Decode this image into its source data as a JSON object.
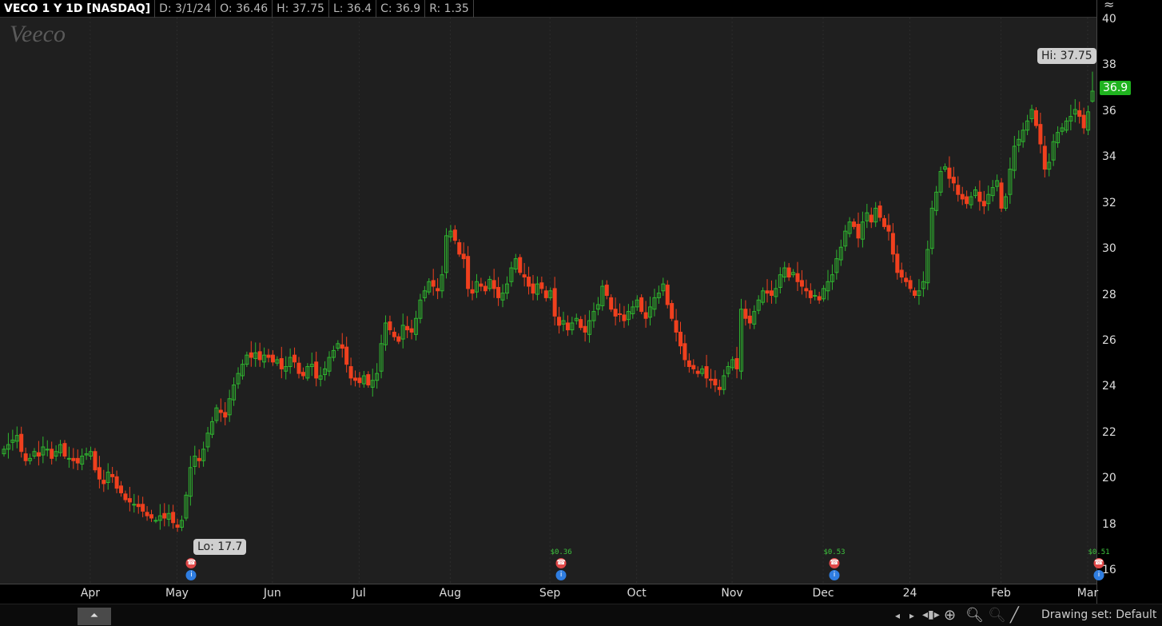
{
  "header": {
    "symbol": "VECO 1 Y 1D [NASDAQ]",
    "date": "D: 3/1/24",
    "open": "O: 36.46",
    "high": "H: 37.75",
    "low": "L: 36.4",
    "close": "C: 36.9",
    "range": "R: 1.35"
  },
  "logo_text": "Veeco",
  "labels": {
    "hi": "Hi: 37.75",
    "lo": "Lo: 17.7",
    "last_price": "36.9"
  },
  "events": [
    {
      "dividend": "",
      "month_index": 1
    },
    {
      "dividend": "$0.36",
      "month_index": 5
    },
    {
      "dividend": "$0.53",
      "month_index": 8
    },
    {
      "dividend": "$0.51",
      "month_index": 11
    }
  ],
  "toolbar": {
    "drawing_set": "Drawing set: Default",
    "collapse": "⏶"
  },
  "colors": {
    "up": "#2fb52f",
    "down": "#f0401e",
    "bg": "#1f1f1f"
  },
  "chart_data": {
    "type": "candlestick",
    "title": "VECO 1 Y 1D [NASDAQ]",
    "ylim": [
      16,
      40
    ],
    "yticks": [
      16,
      18,
      20,
      22,
      24,
      26,
      28,
      30,
      32,
      34,
      36,
      38,
      40
    ],
    "xticks": [
      "Apr",
      "May",
      "Jun",
      "Jul",
      "Aug",
      "Sep",
      "Oct",
      "Nov",
      "Dec",
      "24",
      "Feb",
      "Mar"
    ],
    "xtick_day_index": [
      21,
      41,
      63,
      83,
      104,
      127,
      147,
      169,
      190,
      210,
      231,
      251
    ],
    "closes": [
      21.3,
      21.5,
      21.7,
      21.9,
      21.2,
      20.8,
      20.9,
      21.2,
      21.0,
      21.4,
      21.3,
      20.9,
      21.2,
      21.5,
      21.0,
      20.9,
      20.8,
      20.7,
      21.0,
      21.1,
      21.2,
      20.4,
      20.0,
      19.8,
      20.3,
      20.1,
      19.6,
      19.4,
      19.1,
      19.0,
      18.9,
      18.8,
      18.6,
      18.4,
      18.3,
      18.2,
      18.4,
      18.3,
      18.5,
      18.1,
      17.9,
      18.2,
      19.3,
      20.5,
      21.0,
      20.8,
      21.3,
      22.0,
      22.5,
      23.1,
      22.9,
      22.7,
      23.5,
      24.1,
      24.6,
      25.0,
      25.4,
      25.3,
      25.5,
      25.2,
      25.4,
      25.3,
      25.1,
      25.2,
      24.8,
      24.9,
      25.3,
      25.1,
      24.6,
      24.5,
      24.9,
      25.0,
      24.4,
      24.5,
      24.8,
      25.3,
      25.6,
      25.9,
      25.7,
      25.0,
      24.4,
      24.3,
      24.2,
      24.5,
      24.1,
      24.3,
      24.6,
      25.9,
      26.8,
      26.5,
      26.2,
      26.0,
      26.7,
      26.5,
      26.4,
      27.0,
      27.8,
      28.2,
      28.6,
      28.4,
      28.2,
      28.9,
      30.6,
      30.8,
      30.4,
      29.8,
      29.6,
      28.3,
      28.1,
      28.6,
      28.4,
      28.2,
      28.7,
      28.3,
      27.9,
      28.1,
      28.5,
      29.2,
      29.6,
      29.0,
      28.8,
      28.4,
      28.1,
      28.5,
      28.3,
      27.9,
      28.2,
      27.1,
      26.7,
      26.9,
      26.5,
      26.8,
      27.0,
      26.6,
      26.4,
      26.9,
      27.3,
      27.6,
      28.4,
      28.0,
      27.4,
      27.1,
      27.2,
      26.9,
      27.3,
      27.5,
      27.8,
      27.3,
      27.0,
      27.5,
      27.9,
      28.1,
      28.5,
      27.6,
      27.0,
      26.4,
      25.8,
      25.2,
      24.9,
      24.8,
      24.6,
      24.8,
      24.4,
      24.3,
      24.1,
      23.9,
      24.5,
      24.9,
      25.2,
      24.8,
      27.4,
      27.0,
      26.8,
      27.3,
      27.8,
      28.2,
      28.1,
      28.0,
      28.3,
      28.9,
      29.2,
      28.8,
      29.0,
      28.6,
      28.4,
      28.2,
      27.9,
      28.0,
      27.8,
      28.3,
      28.6,
      28.9,
      29.6,
      30.1,
      30.8,
      31.2,
      31.0,
      30.5,
      31.2,
      31.6,
      31.2,
      31.8,
      31.4,
      31.0,
      30.8,
      29.8,
      29.0,
      28.8,
      28.6,
      28.3,
      28.0,
      28.2,
      28.6,
      30.0,
      31.8,
      32.5,
      33.4,
      33.6,
      33.1,
      32.9,
      32.4,
      32.2,
      32.0,
      32.3,
      32.6,
      32.1,
      31.9,
      32.4,
      32.7,
      33.0,
      31.8,
      32.3,
      33.5,
      34.5,
      34.8,
      35.2,
      35.6,
      36.1,
      35.4,
      34.6,
      33.5,
      33.8,
      34.7,
      35.1,
      35.3,
      35.6,
      35.8,
      36.1,
      35.8,
      35.3,
      36.0
    ],
    "last_candle": {
      "date": "3/1/24",
      "open": 36.46,
      "high": 37.75,
      "low": 36.4,
      "close": 36.9
    },
    "period_high": 37.75,
    "period_low": 17.7
  }
}
